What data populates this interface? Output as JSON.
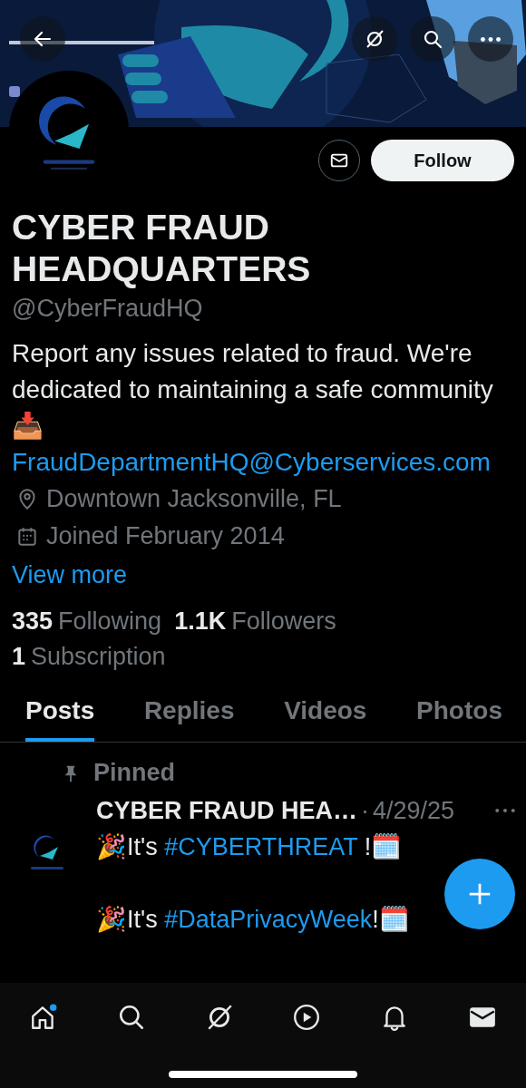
{
  "profile": {
    "name": "CYBER FRAUD HEADQUARTERS",
    "handle": "@CyberFraudHQ",
    "bio": "Report any issues related to fraud. We're dedicated to maintaining a safe community 📥",
    "email": "FraudDepartmentHQ@Cyberservices.com",
    "location": "Downtown Jacksonville, FL",
    "joined": "Joined February 2014",
    "view_more": "View more"
  },
  "follow_button": "Follow",
  "stats": [
    {
      "count": "335",
      "label": "Following"
    },
    {
      "count": "1.1K",
      "label": "Followers"
    },
    {
      "count": "1",
      "label": "Subscription"
    }
  ],
  "tabs": [
    {
      "label": "Posts",
      "selected": true
    },
    {
      "label": "Replies",
      "selected": false
    },
    {
      "label": "Videos",
      "selected": false
    },
    {
      "label": "Photos",
      "selected": false
    }
  ],
  "pinned_post": {
    "pinned_label": "Pinned",
    "author": "CYBER FRAUD HEA…",
    "separator": "·",
    "date": "4/29/25",
    "paragraphs": [
      [
        {
          "kind": "text",
          "text": "🎉It's "
        },
        {
          "kind": "hashtag",
          "text": "#CYBERTHREAT"
        },
        {
          "kind": "text",
          "text": " !🗓️"
        }
      ],
      [
        {
          "kind": "text",
          "text": "🎉It's "
        },
        {
          "kind": "hashtag",
          "text": "#DataPrivacyWeek"
        },
        {
          "kind": "text",
          "text": "!🗓️"
        }
      ]
    ]
  }
}
